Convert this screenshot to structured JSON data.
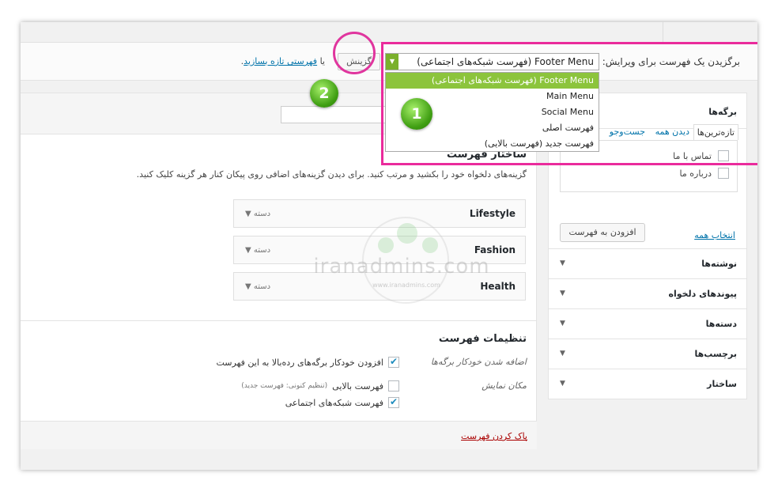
{
  "select_bar": {
    "label": "برگزیدن یک فهرست برای ویرایش:",
    "selected": "Footer Menu (فهرست شبکه‌های اجتماعی)",
    "choose_button": "گزینش",
    "or_prefix": "یا",
    "create_link": "فهرستی تازه بسازید",
    "or_suffix": "."
  },
  "dropdown": {
    "options": [
      "Footer Menu (فهرست شبکه‌های اجتماعی)",
      "Main Menu",
      "Social Menu",
      "فهرست اصلی",
      "فهرست جدید (فهرست بالایی)"
    ]
  },
  "annotations": {
    "badge1": "1",
    "badge2": "2",
    "highlight_color": "#ea2b9c"
  },
  "pages_box": {
    "title": "برگه‌ها",
    "tabs": [
      "تازه‌ترین‌ها",
      "دیدن همه",
      "جست‌وجو"
    ],
    "items": [
      "تماس با ما",
      "درباره ما"
    ],
    "select_all": "انتخاب همه",
    "add_button": "افزودن به فهرست"
  },
  "accordions": [
    "نوشته‌ها",
    "پیوندهای دلخواه",
    "دسته‌ها",
    "برچسب‌ها",
    "ساختار"
  ],
  "menu_structure": {
    "title": "ساختار فهرست",
    "instructions": "گزینه‌های دلخواه خود را بکشید و مرتب کنید. برای دیدن گزینه‌های اضافی روی پیکان کنار هر گزینه کلیک کنید.",
    "items": [
      {
        "title": "Lifestyle",
        "type": "دسته"
      },
      {
        "title": "Fashion",
        "type": "دسته"
      },
      {
        "title": "Health",
        "type": "دسته"
      }
    ]
  },
  "settings": {
    "title": "تنظیمات فهرست",
    "auto_add_label": "اضافه شدن خودکار برگه‌ها",
    "auto_add_option": "افزودن خودکار برگه‌های رده‌بالا به این فهرست",
    "display_label": "مکان نمایش",
    "locations": [
      {
        "label": "فهرست بالایی",
        "note": "(تنظیم کنونی: فهرست جدید)",
        "checked": false
      },
      {
        "label": "فهرست شبکه‌های اجتماعی",
        "note": "",
        "checked": true
      }
    ]
  },
  "delete_link": "پاک کردن فهرست",
  "watermark": {
    "text": "iranadmins.com",
    "sub": "www.iranadmins.com"
  },
  "colors": {
    "accent_green": "#8cc43c",
    "link": "#0073aa",
    "delete": "#aa0000"
  }
}
